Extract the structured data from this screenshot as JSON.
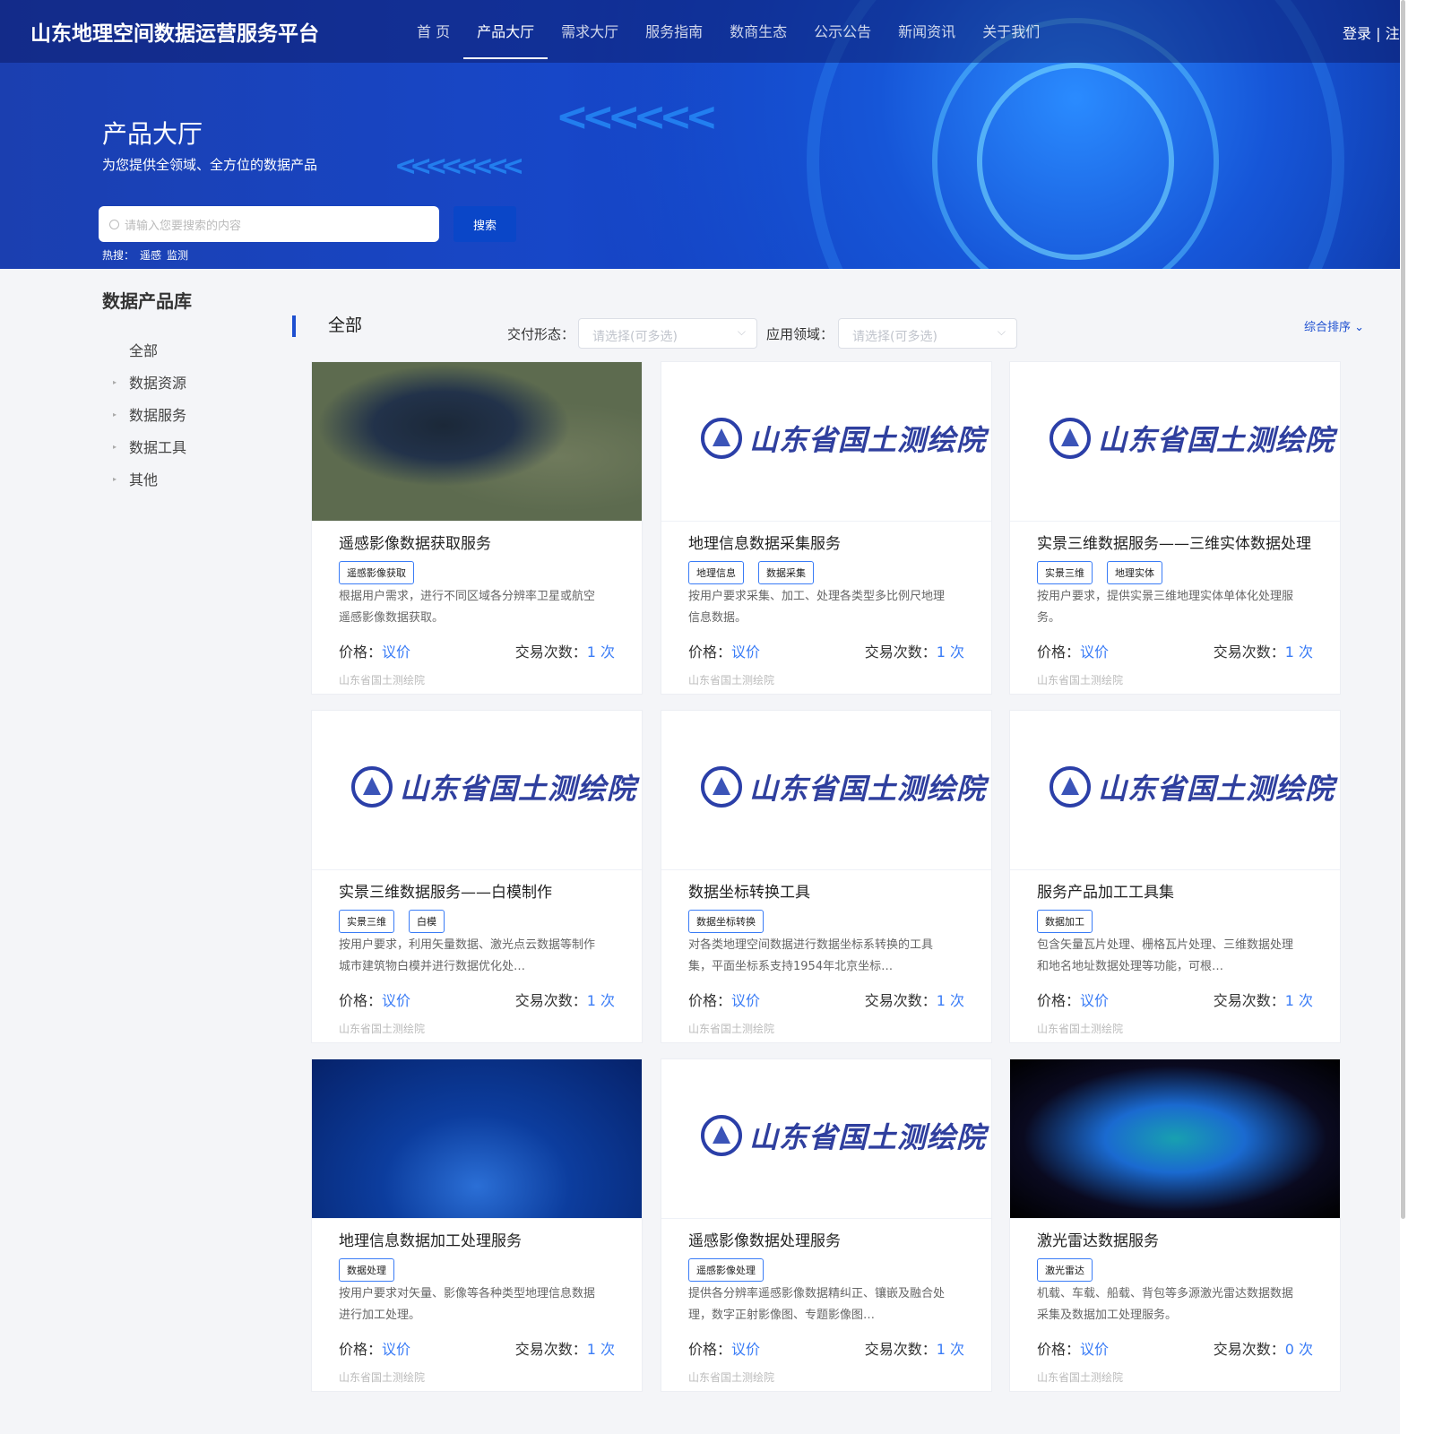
{
  "header": {
    "site_title": "山东地理空间数据运营服务平台",
    "nav": [
      "首 页",
      "产品大厅",
      "需求大厅",
      "服务指南",
      "数商生态",
      "公示公告",
      "新闻资讯",
      "关于我们"
    ],
    "active_nav": 1,
    "auth": "登录 | 注册"
  },
  "hero": {
    "title": "产品大厅",
    "subtitle": "为您提供全领域、全方位的数据产品",
    "search_placeholder": "请输入您要搜索的内容",
    "search_button": "搜索",
    "hot_label": "热搜：",
    "hot_terms": [
      "遥感",
      "监测"
    ]
  },
  "sidebar": {
    "title": "数据产品库",
    "items": [
      "全部",
      "数据资源",
      "数据服务",
      "数据工具",
      "其他"
    ]
  },
  "filters": {
    "current": "全部",
    "delivery_label": "交付形态：",
    "delivery_placeholder": "请选择(可多选)",
    "domain_label": "应用领域：",
    "domain_placeholder": "请选择(可多选)",
    "sort": "综合排序"
  },
  "labels": {
    "price": "价格：",
    "count": "交易次数：",
    "unit": " 次"
  },
  "logo_text": "山东省国土测绘院",
  "colors": {
    "accent": "#3a7cf6",
    "brand": "#1d4fd0"
  },
  "cards": [
    {
      "image": "sat",
      "title": "遥感影像数据获取服务",
      "tags": [
        "遥感影像获取"
      ],
      "desc": "根据用户需求，进行不同区域各分辨率卫星或航空遥感影像数据获取。",
      "price": "议价",
      "count": "1",
      "org": "山东省国土测绘院"
    },
    {
      "image": "logo",
      "title": "地理信息数据采集服务",
      "tags": [
        "地理信息",
        "数据采集"
      ],
      "desc": "按用户要求采集、加工、处理各类型多比例尺地理信息数据。",
      "price": "议价",
      "count": "1",
      "org": "山东省国土测绘院"
    },
    {
      "image": "logo",
      "title": "实景三维数据服务——三维实体数据处理",
      "tags": [
        "实景三维",
        "地理实体"
      ],
      "desc": "按用户要求，提供实景三维地理实体单体化处理服务。",
      "price": "议价",
      "count": "1",
      "org": "山东省国土测绘院"
    },
    {
      "image": "logo",
      "title": "实景三维数据服务——白模制作",
      "tags": [
        "实景三维",
        "白模"
      ],
      "desc": "按用户要求，利用矢量数据、激光点云数据等制作城市建筑物白模并进行数据优化处…",
      "price": "议价",
      "count": "1",
      "org": "山东省国土测绘院"
    },
    {
      "image": "logo",
      "title": "数据坐标转换工具",
      "tags": [
        "数据坐标转换"
      ],
      "desc": "对各类地理空间数据进行数据坐标系转换的工具集，平面坐标系支持1954年北京坐标…",
      "price": "议价",
      "count": "1",
      "org": "山东省国土测绘院"
    },
    {
      "image": "logo",
      "title": "服务产品加工工具集",
      "tags": [
        "数据加工"
      ],
      "desc": "包含矢量瓦片处理、栅格瓦片处理、三维数据处理和地名地址数据处理等功能，可根…",
      "price": "议价",
      "count": "1",
      "org": "山东省国土测绘院"
    },
    {
      "image": "map",
      "title": "地理信息数据加工处理服务",
      "tags": [
        "数据处理"
      ],
      "desc": "按用户要求对矢量、影像等各种类型地理信息数据进行加工处理。",
      "price": "议价",
      "count": "1",
      "org": "山东省国土测绘院"
    },
    {
      "image": "logo",
      "title": "遥感影像数据处理服务",
      "tags": [
        "遥感影像处理"
      ],
      "desc": "提供各分辨率遥感影像数据精纠正、镶嵌及融合处理，数字正射影像图、专题影像图…",
      "price": "议价",
      "count": "1",
      "org": "山东省国土测绘院"
    },
    {
      "image": "lidar",
      "title": "激光雷达数据服务",
      "tags": [
        "激光雷达"
      ],
      "desc": "机载、车载、船载、背包等多源激光雷达数据数据采集及数据加工处理服务。",
      "price": "议价",
      "count": "0",
      "org": "山东省国土测绘院"
    }
  ]
}
